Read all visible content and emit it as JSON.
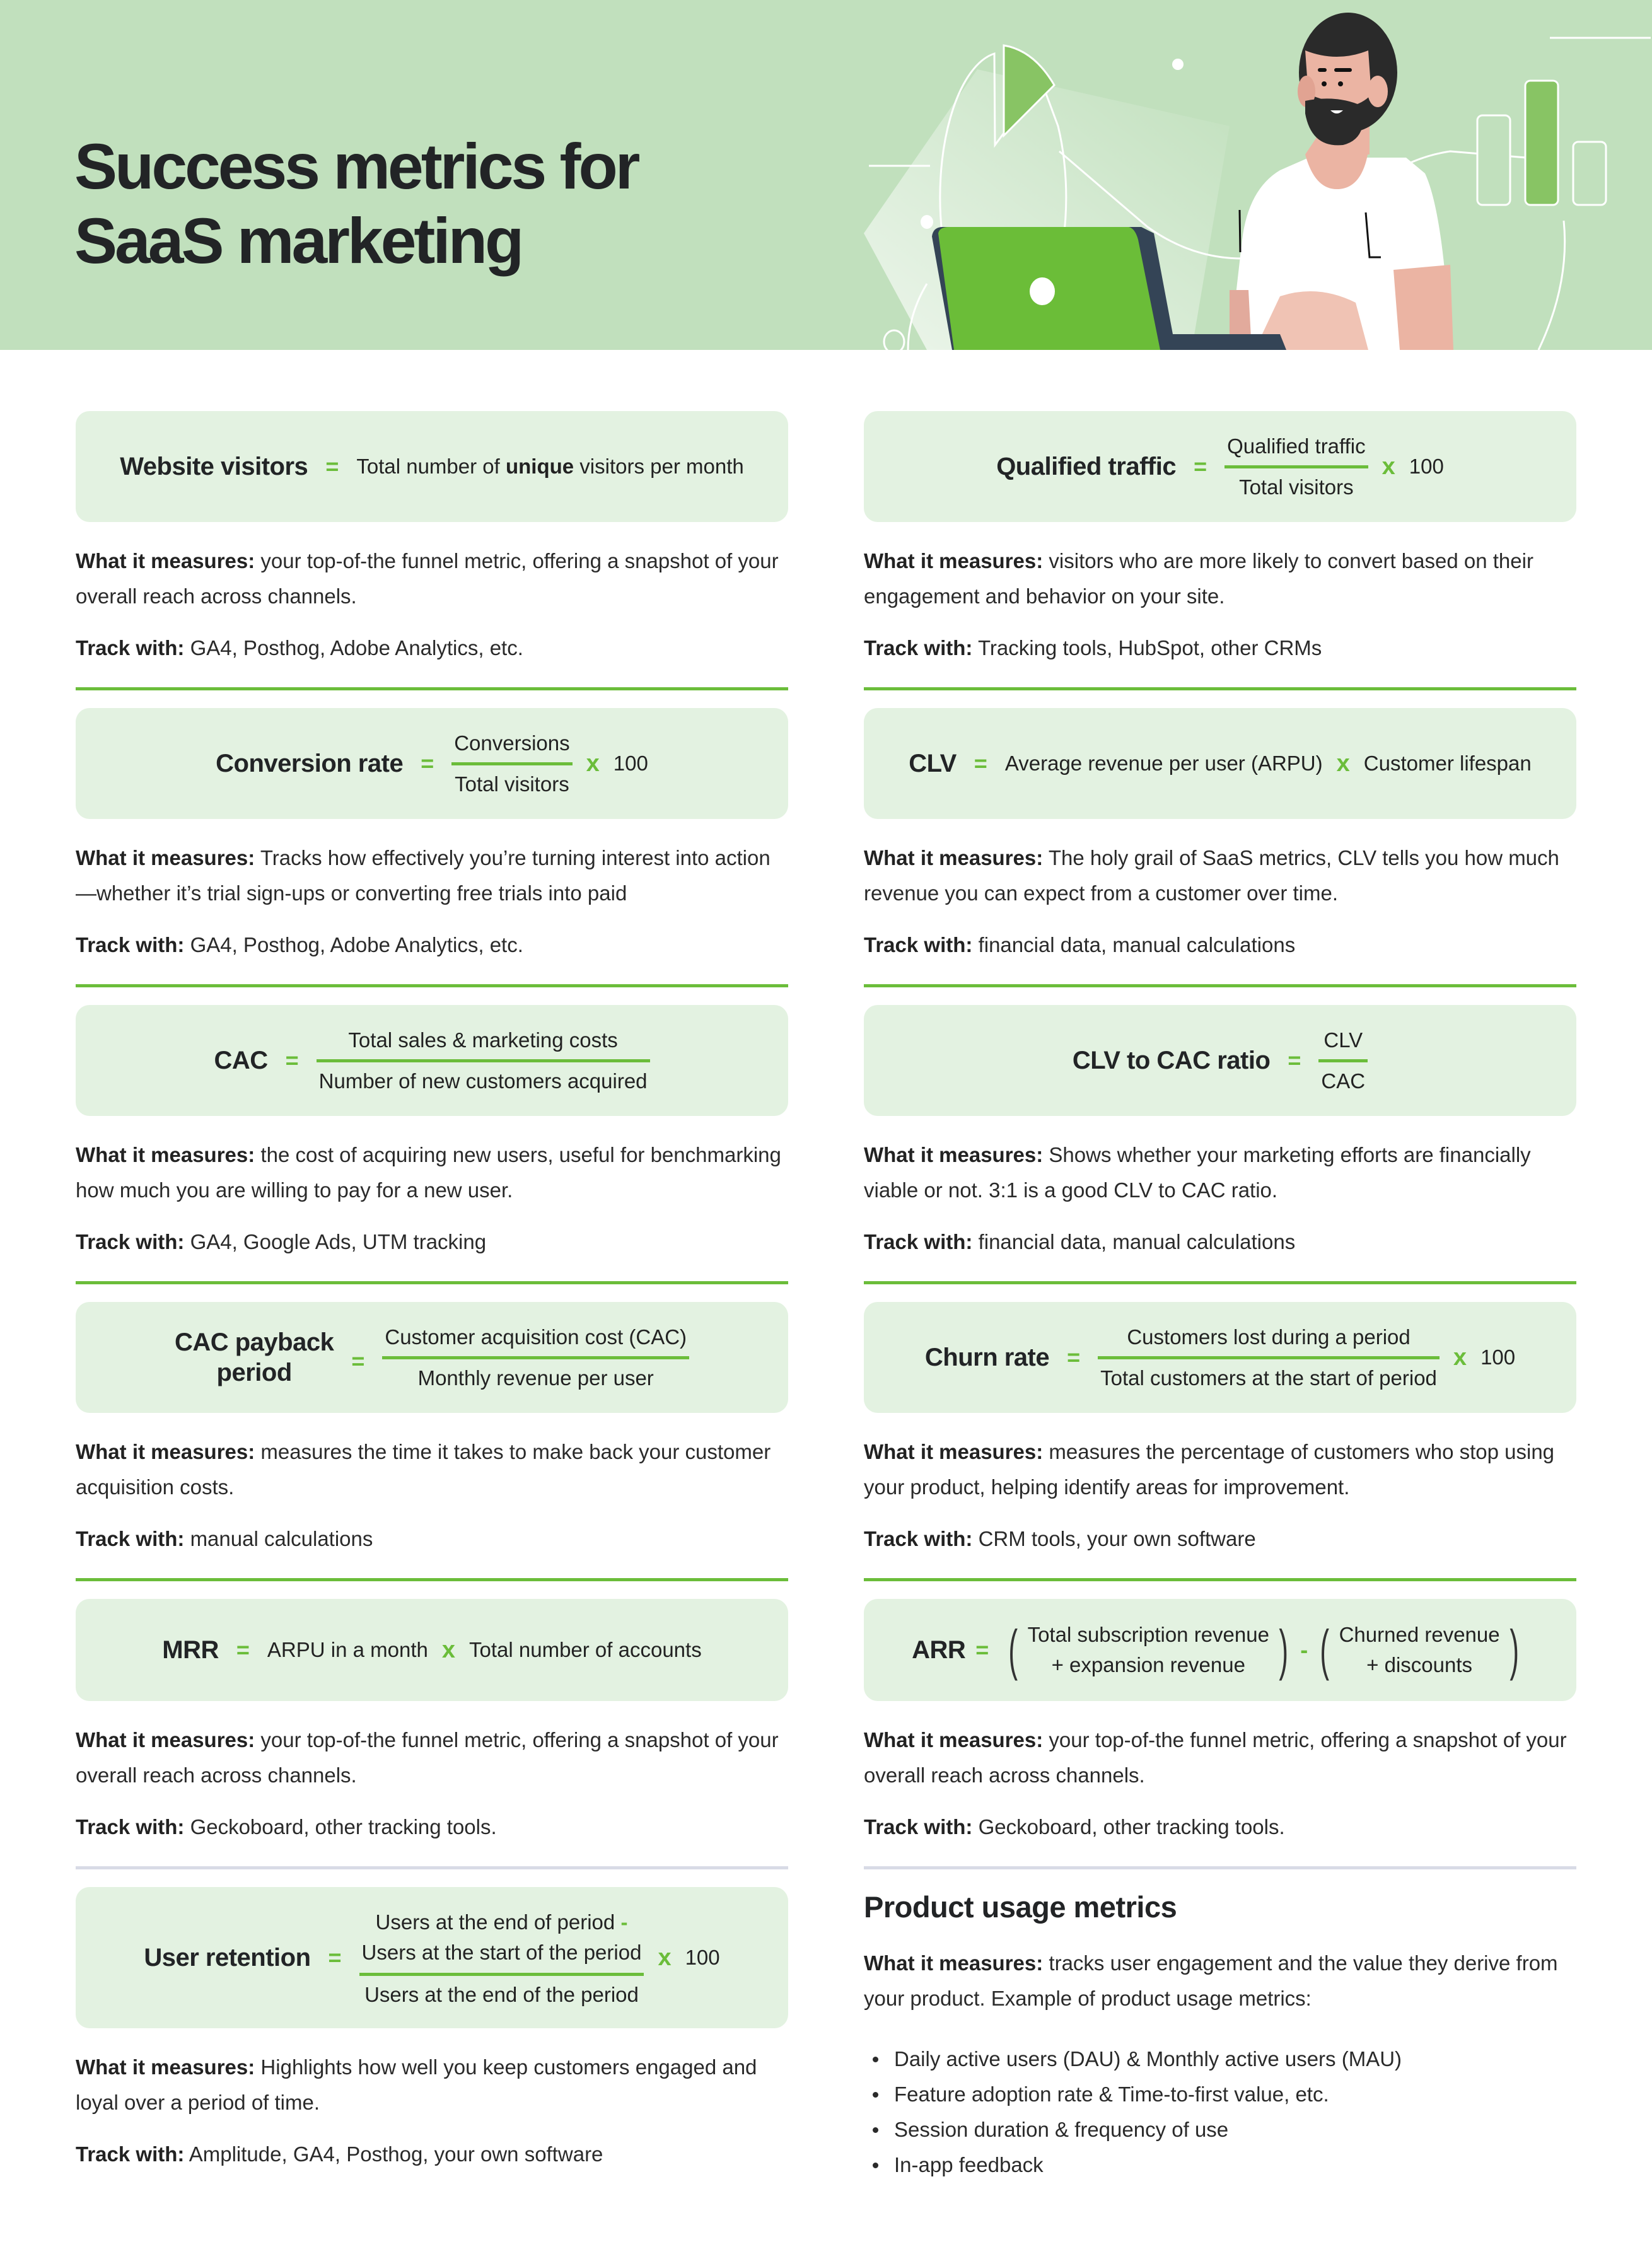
{
  "header": {
    "title_line1": "Success metrics for",
    "title_line2": "SaaS marketing",
    "illustration": "person-with-laptop-and-charts"
  },
  "labels": {
    "what_it_measures": "What it measures:",
    "track_with": "Track with:",
    "equals": "=",
    "times": "x",
    "minus": "-",
    "hundred": "100"
  },
  "colors": {
    "hero_bg": "#c1e0bd",
    "formula_bg": "#e3f2e1",
    "accent_green": "#6bbd3a",
    "separator_gray": "#d8dbe6",
    "laptop_green": "#6bbd38",
    "text_dark": "#222426"
  },
  "metrics": {
    "website_visitors": {
      "name": "Website visitors",
      "formula_pre": "Total number of ",
      "formula_bold": "unique",
      "formula_post": " visitors per month",
      "what": "your top-of-the funnel metric, offering a snapshot of your overall reach across channels.",
      "track": "GA4, Posthog, Adobe Analytics, etc."
    },
    "qualified_traffic": {
      "name": "Qualified traffic",
      "numerator": "Qualified traffic",
      "denominator": "Total visitors",
      "multiplier": "100",
      "what": "visitors who are more likely to convert based on their engagement and behavior on your site.",
      "track": "Tracking tools, HubSpot, other CRMs"
    },
    "conversion_rate": {
      "name": "Conversion rate",
      "numerator": "Conversions",
      "denominator": "Total visitors",
      "multiplier": "100",
      "what": "Tracks how effectively you’re turning interest into action—whether it’s trial sign-ups or converting free trials into paid",
      "track": "GA4, Posthog, Adobe Analytics, etc."
    },
    "clv": {
      "name": "CLV",
      "term1": "Average revenue per user (ARPU)",
      "term2": "Customer lifespan",
      "what": "The holy grail of SaaS metrics, CLV tells you how much revenue you can expect from a customer over time.",
      "track": "financial data, manual calculations"
    },
    "cac": {
      "name": "CAC",
      "numerator": "Total sales & marketing costs",
      "denominator": "Number of new customers acquired",
      "what": "the cost of acquiring new users, useful for benchmarking how much you are willing to pay for a new user.",
      "track": "GA4, Google Ads, UTM tracking"
    },
    "clv_cac_ratio": {
      "name": "CLV to CAC ratio",
      "numerator": "CLV",
      "denominator": "CAC",
      "what": "Shows whether your marketing efforts are financially viable or not. 3:1 is a good CLV to CAC ratio.",
      "track": "financial data, manual calculations"
    },
    "cac_payback": {
      "name_line1": "CAC payback",
      "name_line2": "period",
      "numerator": "Customer acquisition cost (CAC)",
      "denominator": "Monthly revenue per user",
      "what": "measures the time it takes to make back your customer acquisition costs.",
      "track": "manual calculations"
    },
    "churn_rate": {
      "name": "Churn rate",
      "numerator": "Customers lost during a period",
      "denominator": "Total customers at the start of period",
      "multiplier": "100",
      "what": "measures the percentage of customers who stop using your product, helping identify areas for improvement.",
      "track": "CRM tools, your own software"
    },
    "mrr": {
      "name": "MRR",
      "term1": "ARPU in a month",
      "term2": "Total number of accounts",
      "what": "your top-of-the funnel metric, offering a snapshot of your overall reach across channels.",
      "track": "Geckoboard, other tracking tools."
    },
    "arr": {
      "name": "ARR",
      "group1_line1": "Total subscription revenue",
      "group1_line2": "+ expansion revenue",
      "group2_line1": "Churned revenue",
      "group2_line2": "+ discounts",
      "what": "your top-of-the funnel metric, offering a snapshot of your overall reach across channels.",
      "track": "Geckoboard, other tracking tools."
    },
    "user_retention": {
      "name": "User retention",
      "numerator_line1": "Users at the end of period",
      "numerator_line2": "Users at the start of the period",
      "denominator": "Users at the end of the period",
      "multiplier": "100",
      "what": "Highlights how well you keep customers engaged and loyal over a period of time.",
      "track": "Amplitude, GA4, Posthog, your own software"
    }
  },
  "product_usage": {
    "title": "Product usage metrics",
    "what": "tracks user engagement and the value they derive from your product. Example of product usage metrics:",
    "items": [
      "Daily active users (DAU) & Monthly active users (MAU)",
      "Feature adoption rate & Time-to-first value, etc.",
      "Session duration & frequency of use",
      "In-app feedback"
    ]
  }
}
